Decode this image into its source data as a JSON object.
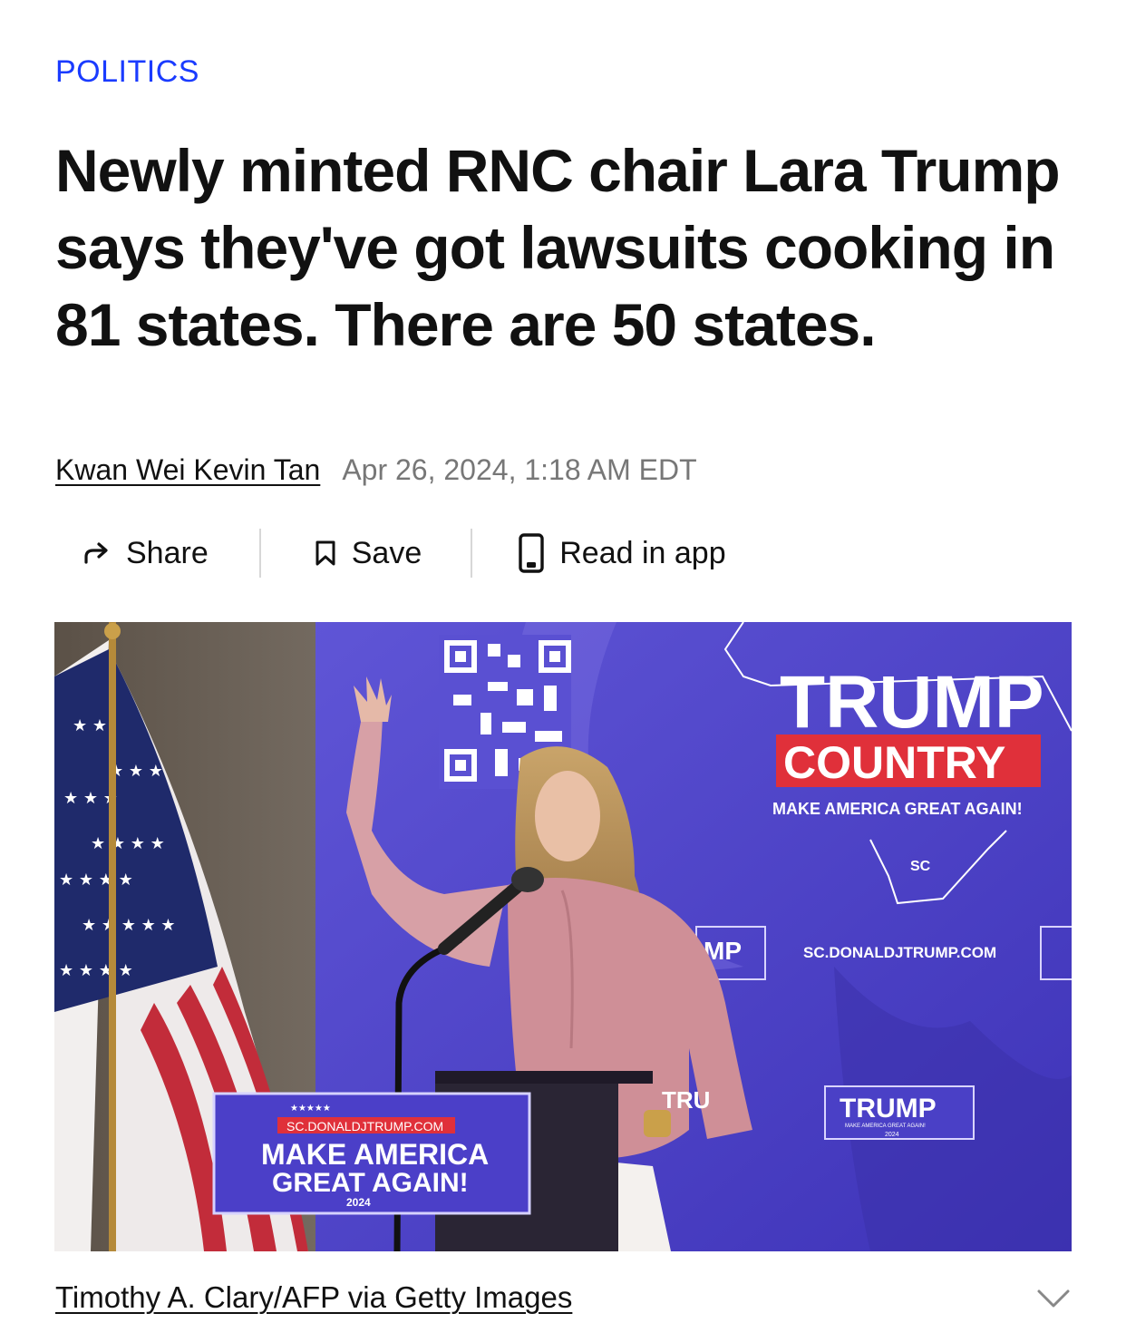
{
  "article": {
    "category": "POLITICS",
    "headline": "Newly minted RNC chair Lara Trump says they've got lawsuits cooking in 81 states. There are 50 states.",
    "author": "Kwan Wei Kevin Tan",
    "date": "Apr 26, 2024, 1:18 AM EDT"
  },
  "actions": {
    "share_label": "Share",
    "save_label": "Save",
    "read_in_app_label": "Read in app"
  },
  "photo": {
    "credit": "Timothy A. Clary/AFP via Getty Images",
    "signage": {
      "banner_title": "TRUMP",
      "banner_country": "COUNTRY",
      "banner_slogan": "MAKE AMERICA GREAT AGAIN!",
      "banner_state": "SC",
      "banner_url": "SC.DONALDJTRUMP.COM",
      "podium_url": "SC.DONALDJTRUMP.COM",
      "podium_line1": "MAKE AMERICA",
      "podium_line2": "GREAT AGAIN!",
      "podium_year": "2024",
      "small_sign_title": "TRUMP",
      "small_sign_slogan": "MAKE AMERICA GREAT AGAIN!",
      "small_sign_year": "2024",
      "partial_mp": "MP",
      "partial_tru": "TRU"
    }
  },
  "icons": {
    "share": "share-arrow-icon",
    "save": "bookmark-icon",
    "app": "phone-icon",
    "expand": "chevron-down-icon"
  },
  "colors": {
    "category_blue": "#1a3bff",
    "backdrop_purple": "#4a3fc4",
    "sign_red": "#e0303a"
  }
}
